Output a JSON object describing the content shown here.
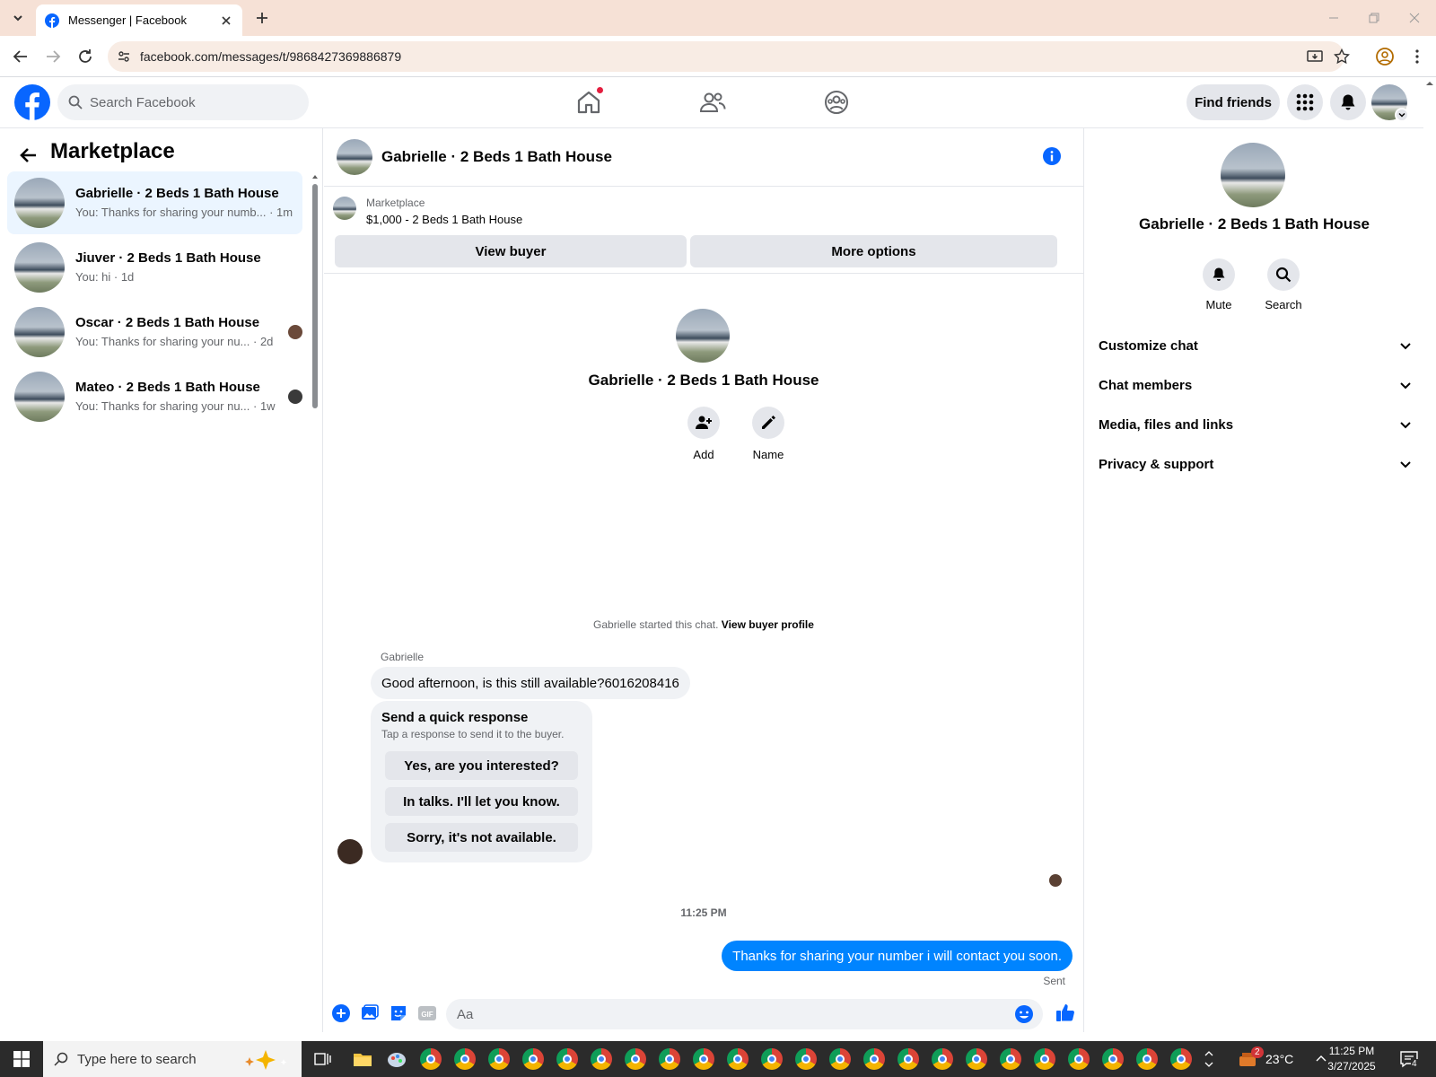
{
  "browser": {
    "tab_title": "Messenger | Facebook",
    "url": "facebook.com/messages/t/9868427369886879"
  },
  "fb": {
    "search_placeholder": "Search Facebook",
    "find_friends": "Find friends",
    "brand_color": "#0866ff"
  },
  "sidebar": {
    "title": "Marketplace",
    "conversations": [
      {
        "name": "Gabrielle · 2 Beds 1 Bath House",
        "preview": "You: Thanks for sharing your numb... · 1m",
        "active": true
      },
      {
        "name": "Jiuver · 2 Beds 1 Bath House",
        "preview": "You: hi · 1d",
        "active": false
      },
      {
        "name": "Oscar · 2 Beds 1 Bath House",
        "preview": "You: Thanks for sharing your nu... · 2d",
        "active": false
      },
      {
        "name": "Mateo · 2 Beds 1 Bath House",
        "preview": "You: Thanks for sharing your nu... · 1w",
        "active": false
      }
    ]
  },
  "chat": {
    "title": "Gabrielle · 2 Beds 1 Bath House",
    "listing_kicker": "Marketplace",
    "listing_title": "$1,000 - 2 Beds 1 Bath House",
    "view_buyer": "View buyer",
    "more_options": "More options",
    "center_name": "Gabrielle · 2 Beds 1 Bath House",
    "add_label": "Add",
    "name_label": "Name",
    "started_text": "Gabrielle started this chat.",
    "view_buyer_profile": "View buyer profile",
    "sender_name": "Gabrielle",
    "incoming_message": "Good afternoon, is this still available?6016208416",
    "quick_title": "Send a quick response",
    "quick_sub": "Tap a response to send it to the buyer.",
    "quick_replies": [
      "Yes, are you interested?",
      "In talks. I'll let you know.",
      "Sorry, it's not available."
    ],
    "timestamp": "11:25 PM",
    "outgoing_message": "Thanks for sharing your number i will contact you soon.",
    "sent_status": "Sent",
    "composer_placeholder": "Aa"
  },
  "details": {
    "name": "Gabrielle · 2 Beds 1 Bath House",
    "mute": "Mute",
    "search": "Search",
    "sections": [
      "Customize chat",
      "Chat members",
      "Media, files and links",
      "Privacy & support"
    ]
  },
  "taskbar": {
    "search_placeholder": "Type here to search",
    "temperature": "23°C",
    "weather_badge": "2",
    "time": "11:25 PM",
    "date": "3/27/2025",
    "notifications": "4"
  }
}
